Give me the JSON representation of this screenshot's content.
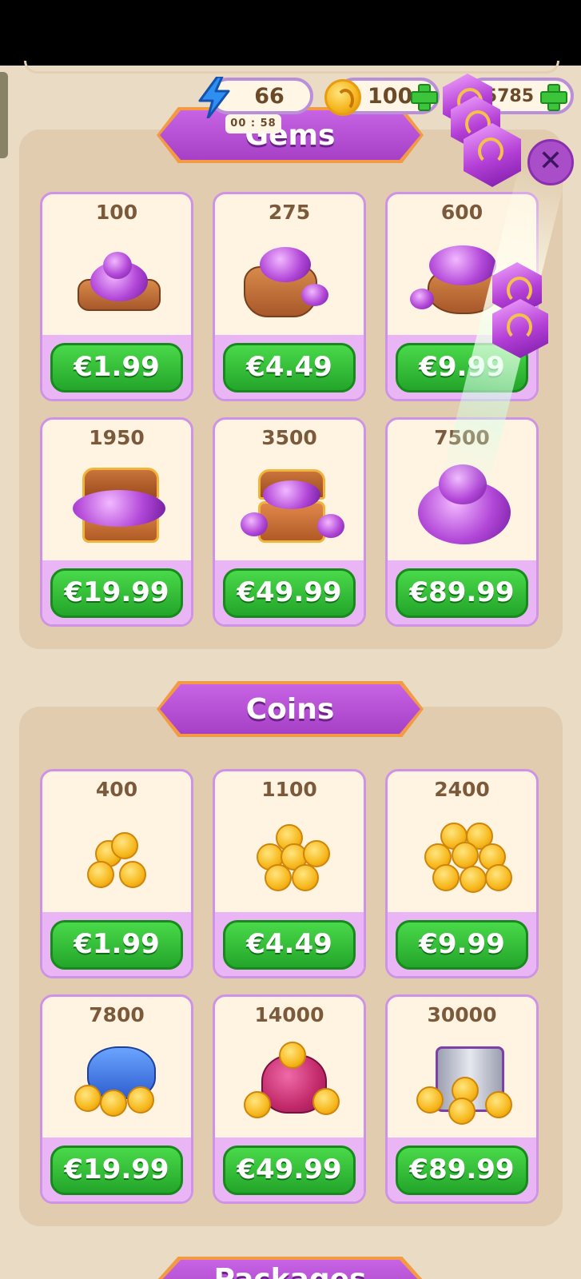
{
  "hud": {
    "energy_value": "66",
    "energy_timer": "00 : 58",
    "coins_value": "100",
    "gems_value": "5785"
  },
  "sections": {
    "gems_title": "Gems",
    "coins_title": "Coins",
    "packages_title": "Packages"
  },
  "gems_offers": [
    {
      "amount": "100",
      "price": "€1.99"
    },
    {
      "amount": "275",
      "price": "€4.49"
    },
    {
      "amount": "600",
      "price": "€9.99"
    },
    {
      "amount": "1950",
      "price": "€19.99"
    },
    {
      "amount": "3500",
      "price": "€49.99"
    },
    {
      "amount": "7500",
      "price": "€89.99"
    }
  ],
  "coins_offers": [
    {
      "amount": "400",
      "price": "€1.99"
    },
    {
      "amount": "1100",
      "price": "€4.49"
    },
    {
      "amount": "2400",
      "price": "€9.99"
    },
    {
      "amount": "7800",
      "price": "€19.99"
    },
    {
      "amount": "14000",
      "price": "€49.99"
    },
    {
      "amount": "30000",
      "price": "€89.99"
    }
  ],
  "icons": {
    "energy": "lightning-bolt-icon",
    "coin": "coin-icon",
    "gem": "gem-icon",
    "add": "plus-icon",
    "close": "close-icon"
  },
  "colors": {
    "background": "#eadbc4",
    "panel": "#e1ccaf",
    "banner": "#b14fd0",
    "price_button": "#2fb834",
    "card_accent": "#e9b5f5"
  }
}
